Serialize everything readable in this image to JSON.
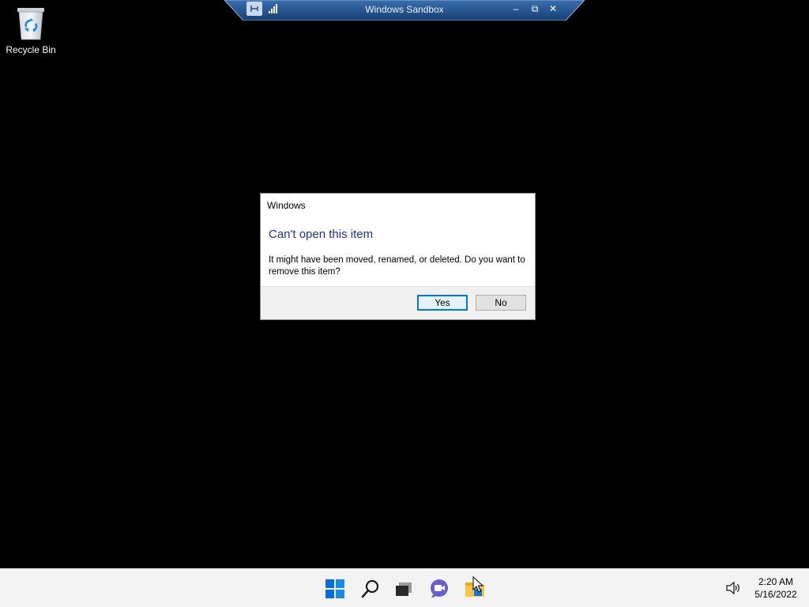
{
  "connection_bar": {
    "title": "Windows Sandbox",
    "icons": [
      "pin-icon",
      "signal-icon"
    ],
    "buttons": {
      "minimize": "–",
      "restore": "⧉",
      "close": "✕"
    }
  },
  "desktop": {
    "icons": [
      {
        "label": "Recycle Bin",
        "icon": "recycle-bin-icon"
      }
    ]
  },
  "dialog": {
    "caption": "Windows",
    "heading": "Can't open this item",
    "message": "It might have been moved, renamed, or deleted. Do you want to remove this item?",
    "buttons": {
      "yes": "Yes",
      "no": "No"
    }
  },
  "taskbar": {
    "apps": [
      "start-icon",
      "search-icon",
      "task-view-icon",
      "teams-chat-icon",
      "file-explorer-icon"
    ],
    "tray": {
      "volume_icon": "volume-icon"
    },
    "clock": {
      "time": "2:20 AM",
      "date": "5/16/2022"
    }
  },
  "colors": {
    "desktop_bg": "#000000",
    "dialog_heading": "#1e3287",
    "accent": "#0078d7",
    "conn_bar": "#1f4f8c"
  }
}
